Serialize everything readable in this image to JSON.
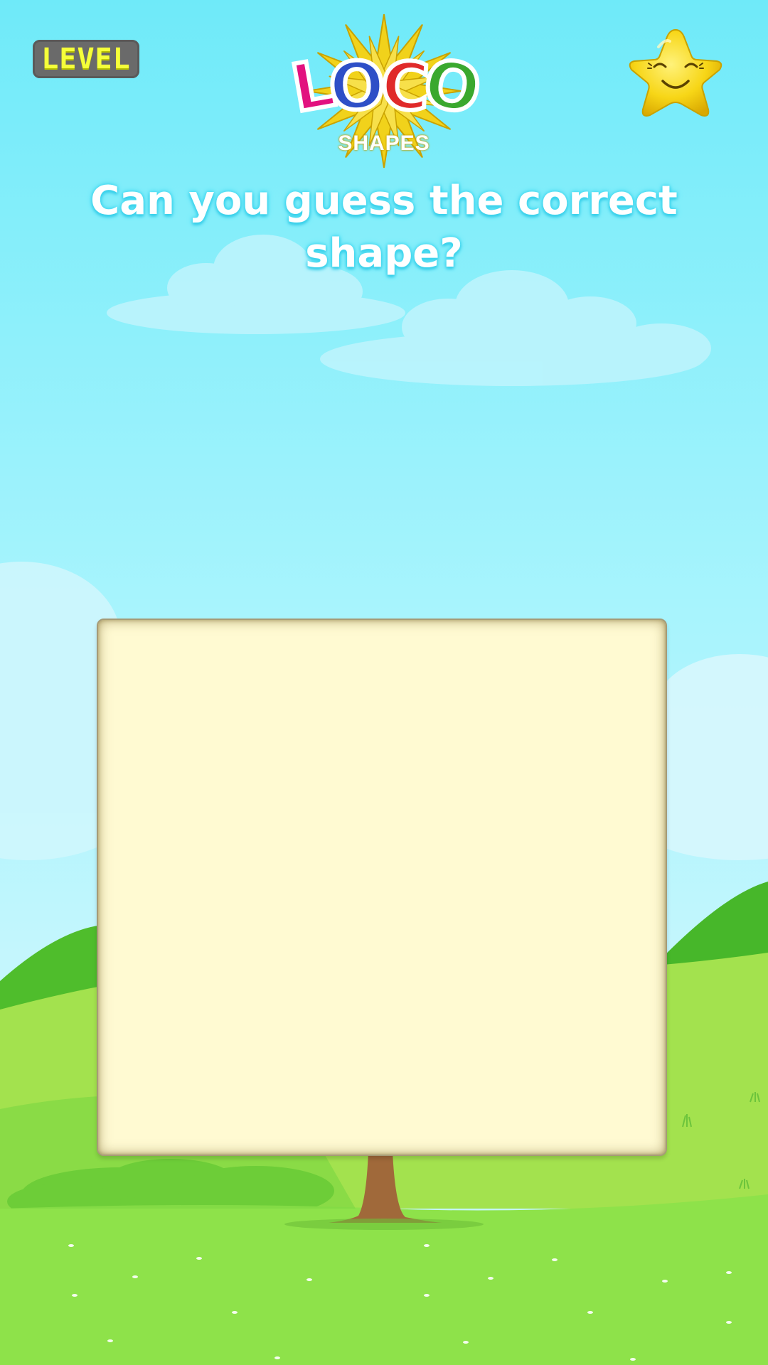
{
  "header": {
    "level_label": "LEVEL",
    "logo": {
      "letters": [
        "L",
        "O",
        "C",
        "O"
      ],
      "subtitle": "SHAPES"
    },
    "star_icon": "smiling-star-icon"
  },
  "question": "Can you guess the correct shape?",
  "board": {
    "content": ""
  },
  "colors": {
    "sky_top": "#6feaf9",
    "sky_bottom": "#c4f6fd",
    "grass_light": "#8ee24a",
    "grass_dark": "#47b72a",
    "board_fill": "#fffad2",
    "level_text": "#f5ff3a",
    "star": "#f7d617",
    "tree_trunk": "#a0693a"
  }
}
